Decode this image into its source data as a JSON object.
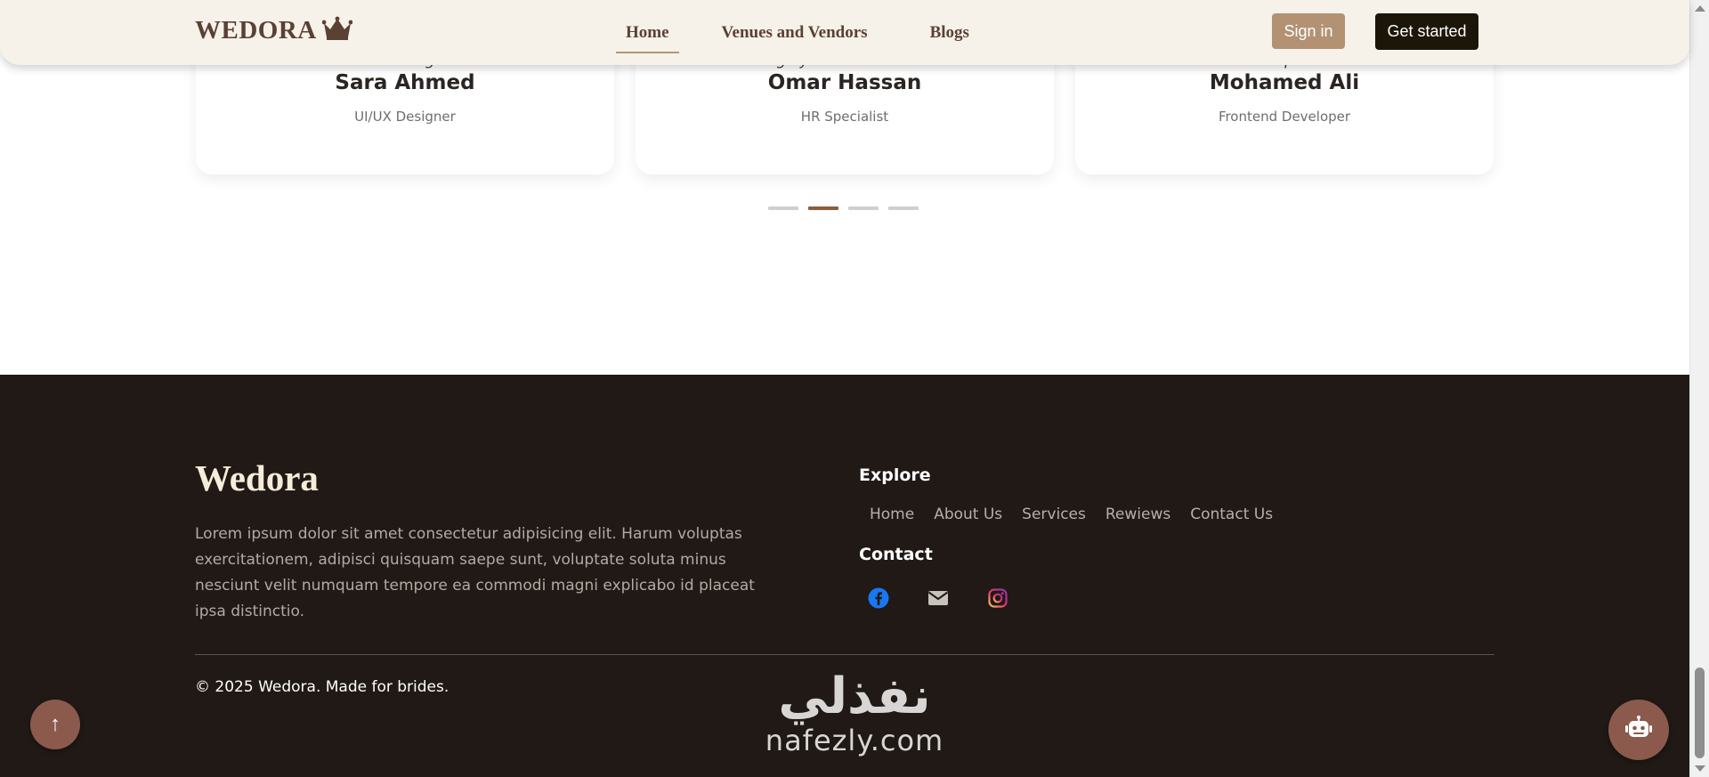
{
  "navbar": {
    "brand": "WEDORA",
    "links": [
      "Home",
      "Venues and Vendors",
      "Blogs"
    ],
    "active_link": "Home",
    "signin_label": "Sign in",
    "get_started_label": "Get started"
  },
  "testimonials": [
    {
      "quote_tail": "amazing.",
      "name": "Sara Ahmed",
      "role": "UI/UX Designer"
    },
    {
      "quote_tail": "Highly recommended.",
      "name": "Omar Hassan",
      "role": "HR Specialist"
    },
    {
      "quote_tail": "than expected.",
      "name": "Mohamed Ali",
      "role": "Frontend Developer"
    }
  ],
  "carousel": {
    "active_dot": 2,
    "dot_count": 4
  },
  "footer": {
    "title": "Wedora",
    "description": "Lorem ipsum dolor sit amet consectetur adipisicing elit. Harum voluptas exercitationem, adipisci quisquam saepe sunt, voluptate soluta minus nesciunt velit numquam tempore ea commodi magni explicabo id placeat ipsa distinctio.",
    "explore_heading": "Explore",
    "explore_links": [
      "Home",
      "About Us",
      "Services",
      "Rewiews",
      "Contact Us"
    ],
    "contact_heading": "Contact",
    "socials": [
      "facebook-icon",
      "mail-icon",
      "instagram-icon"
    ],
    "copyright": "© 2025 Wedora. Made for brides."
  },
  "watermark": {
    "arabic": "نفذلي",
    "latin": "nafezly.com"
  },
  "colors": {
    "nav_bg": "#f6f2ea",
    "brand": "#5b4034",
    "signin_bg": "#b29272",
    "get_started_bg": "#1c1609",
    "footer_bg": "#201915",
    "dot_active": "#8b5e3c",
    "floating_button": "#8b5a4d"
  },
  "icons": {
    "to_top": "↑",
    "brand_icon": "crown-icon",
    "chat_icon": "robot-icon"
  }
}
